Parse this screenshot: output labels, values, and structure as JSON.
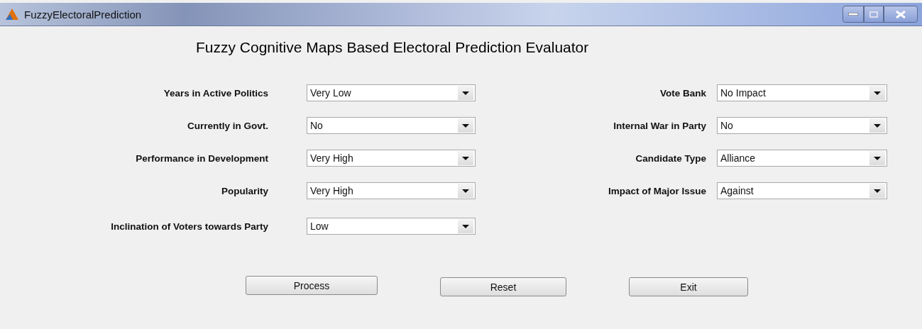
{
  "window": {
    "title": "FuzzyElectoralPrediction"
  },
  "heading": "Fuzzy Cognitive Maps Based Electoral Prediction Evaluator",
  "left_fields": [
    {
      "label": "Years in Active Politics",
      "value": "Very Low"
    },
    {
      "label": "Currently in Govt.",
      "value": "No"
    },
    {
      "label": "Performance in Development",
      "value": "Very High"
    },
    {
      "label": "Popularity",
      "value": "Very High"
    },
    {
      "label": "Inclination of Voters towards Party",
      "value": "Low"
    }
  ],
  "right_fields": [
    {
      "label": "Vote Bank",
      "value": "No Impact"
    },
    {
      "label": "Internal War in Party",
      "value": "No"
    },
    {
      "label": "Candidate Type",
      "value": "Alliance"
    },
    {
      "label": "Impact of Major Issue",
      "value": "Against"
    }
  ],
  "buttons": [
    "Process",
    "Reset",
    "Exit"
  ]
}
